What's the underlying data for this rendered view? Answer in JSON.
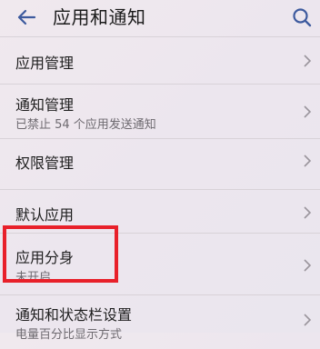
{
  "header": {
    "title": "应用和通知",
    "back_icon": "arrow-left-icon",
    "search_icon": "search-icon"
  },
  "items": [
    {
      "label": "应用管理",
      "subtitle": ""
    },
    {
      "label": "通知管理",
      "subtitle": "已禁止 54 个应用发送通知"
    },
    {
      "label": "权限管理",
      "subtitle": ""
    },
    {
      "label": "默认应用",
      "subtitle": ""
    },
    {
      "label": "应用分身",
      "subtitle": "未开启"
    },
    {
      "label": "通知和状态栏设置",
      "subtitle": "电量百分比显示方式"
    }
  ],
  "colors": {
    "highlight": "#e8202a",
    "accent": "#3d5a9e"
  }
}
